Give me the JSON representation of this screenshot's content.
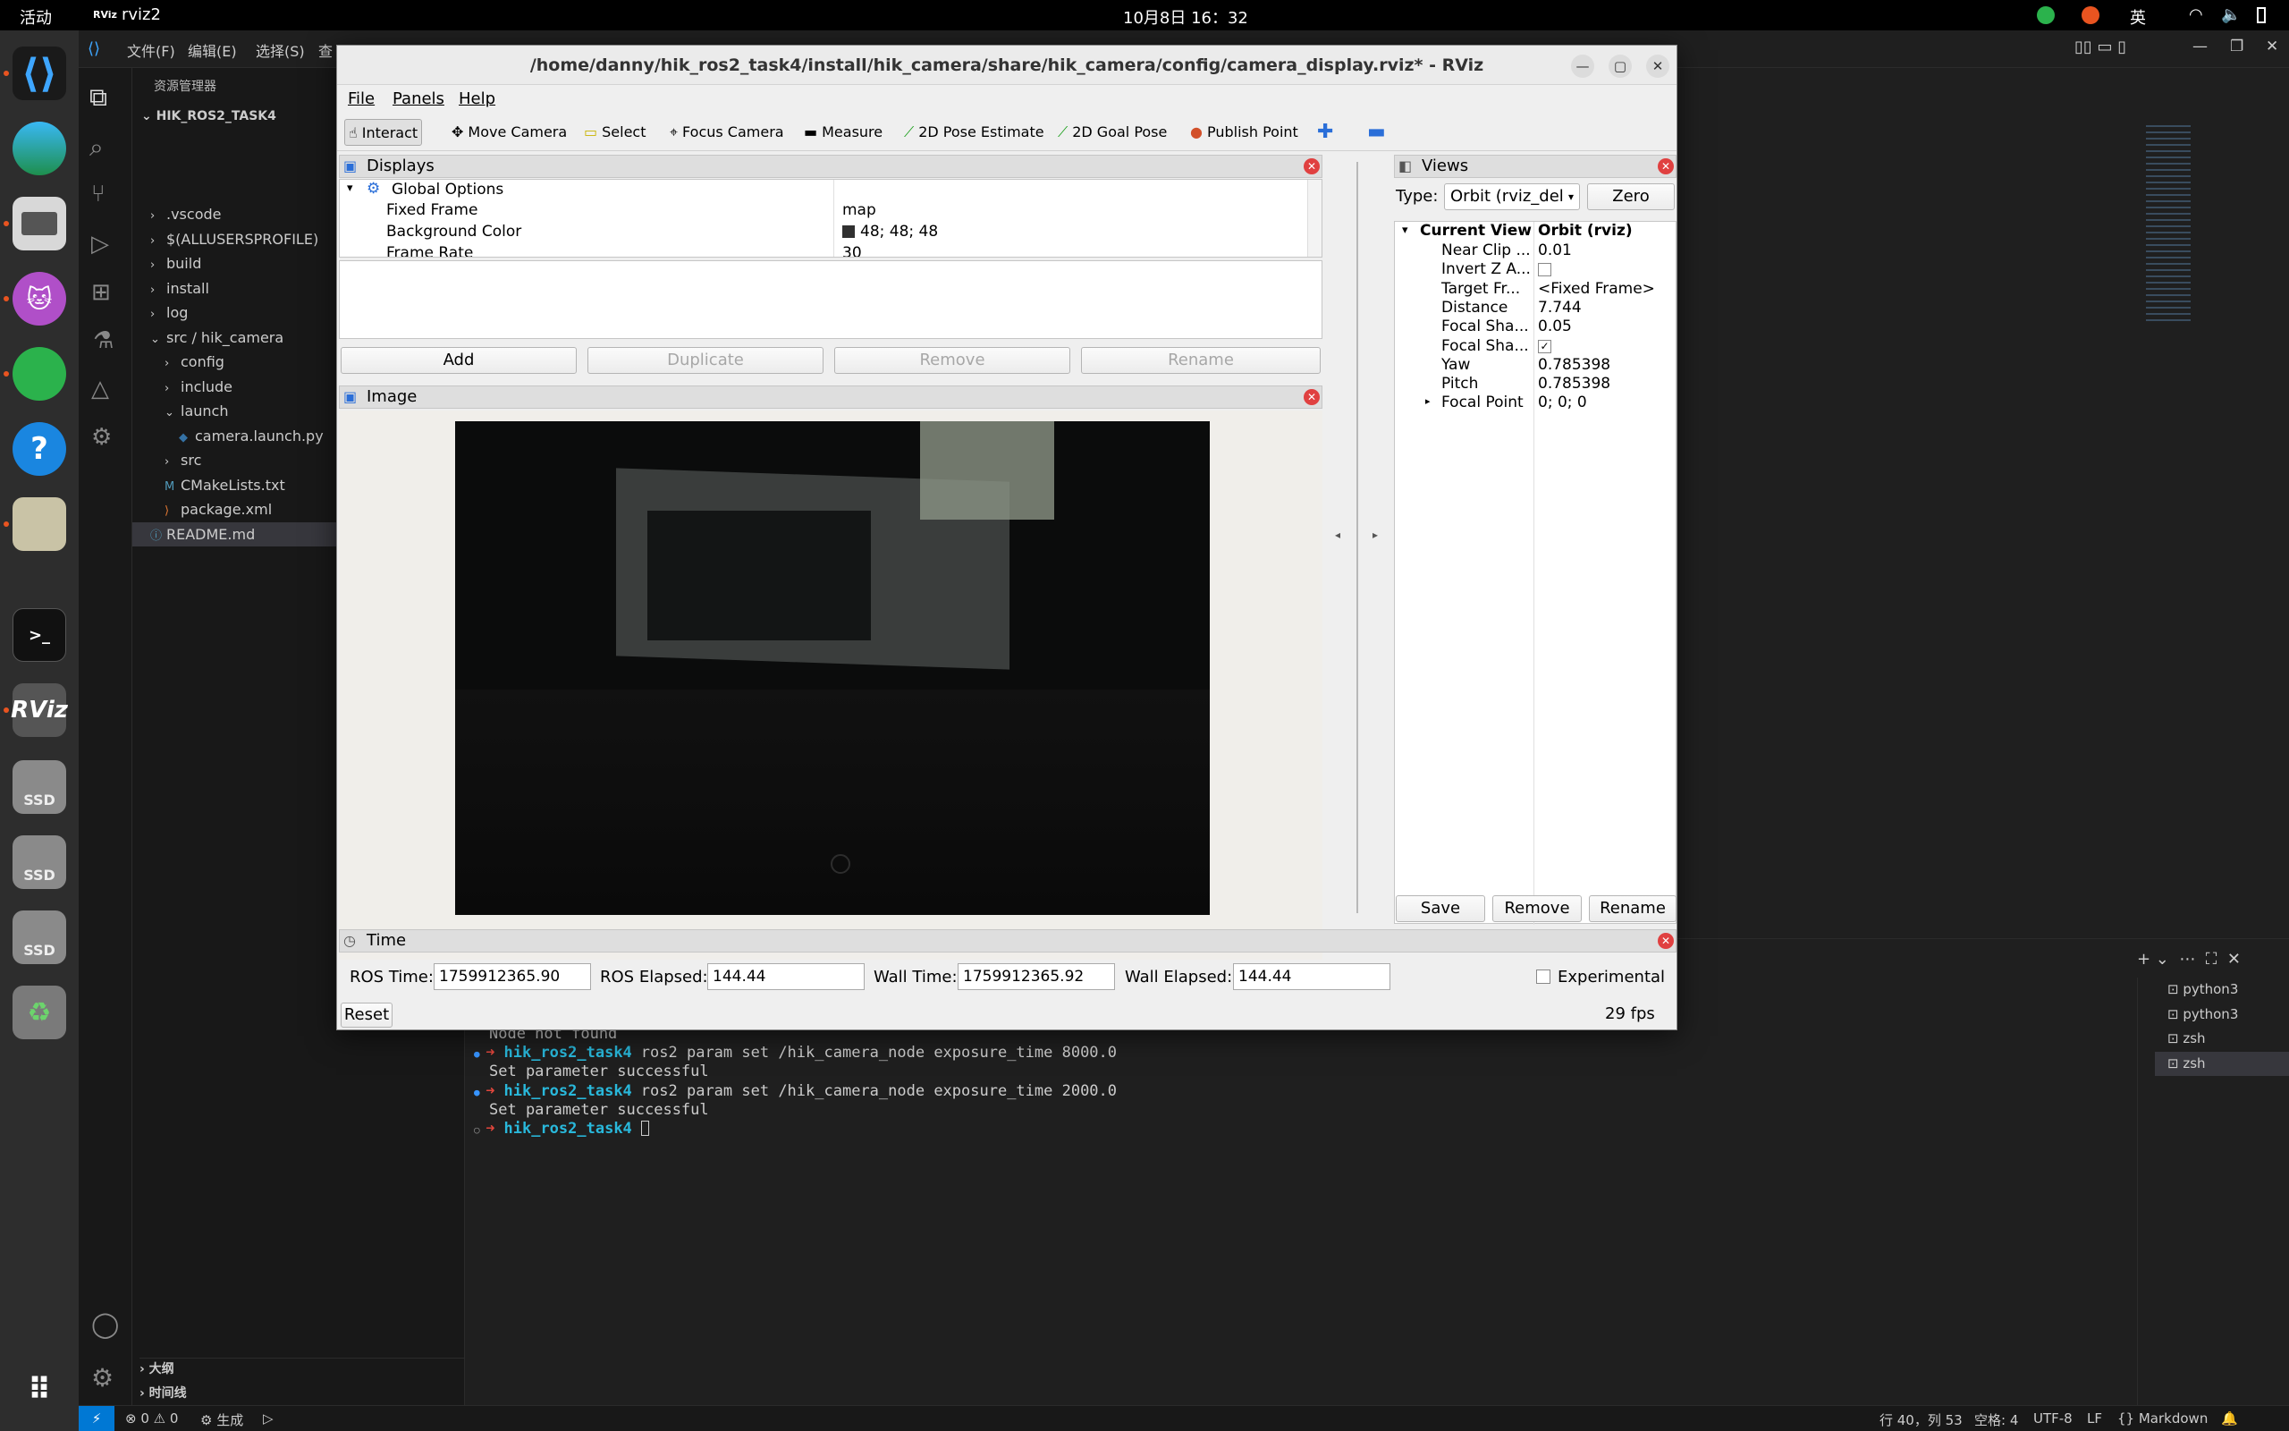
{
  "topbar": {
    "activities": "活动",
    "app_name": "rviz2",
    "clock": "10月8日  16：32",
    "ime": "英"
  },
  "vscode": {
    "menus": [
      "文件(F)",
      "编辑(E)",
      "选择(S)",
      "查"
    ],
    "explorer_title": "资源管理器",
    "project": "HIK_ROS2_TASK4",
    "tree": [
      {
        "label": ".vscode",
        "depth": 1,
        "kind": "folder",
        "open": false
      },
      {
        "label": "$(ALLUSERSPROFILE)",
        "depth": 1,
        "kind": "folder",
        "open": false
      },
      {
        "label": "build",
        "depth": 1,
        "kind": "folder",
        "open": false
      },
      {
        "label": "install",
        "depth": 1,
        "kind": "folder",
        "open": false
      },
      {
        "label": "log",
        "depth": 1,
        "kind": "folder",
        "open": false
      },
      {
        "label": "src / hik_camera",
        "depth": 1,
        "kind": "folder",
        "open": true
      },
      {
        "label": "config",
        "depth": 2,
        "kind": "folder",
        "open": false
      },
      {
        "label": "include",
        "depth": 2,
        "kind": "folder",
        "open": false
      },
      {
        "label": "launch",
        "depth": 2,
        "kind": "folder",
        "open": true
      },
      {
        "label": "camera.launch.py",
        "depth": 3,
        "kind": "py"
      },
      {
        "label": "src",
        "depth": 2,
        "kind": "folder",
        "open": false
      },
      {
        "label": "CMakeLists.txt",
        "depth": 2,
        "kind": "cmake"
      },
      {
        "label": "package.xml",
        "depth": 2,
        "kind": "xml"
      },
      {
        "label": "README.md",
        "depth": 1,
        "kind": "md"
      }
    ],
    "outline": "大纲",
    "timeline": "时间线",
    "terminal_lines": [
      {
        "arrow": "",
        "dir": "",
        "cmd": "Node not found"
      },
      {
        "arrow": "➜",
        "dir": "hik_ros2_task4",
        "cmd": "ros2 param set /hik_camera_node exposure_time 8000.0"
      },
      {
        "arrow": "",
        "dir": "",
        "cmd": "Set parameter successful"
      },
      {
        "arrow": "➜",
        "dir": "hik_ros2_task4",
        "cmd": "ros2 param set /hik_camera_node exposure_time 2000.0"
      },
      {
        "arrow": "",
        "dir": "",
        "cmd": "Set parameter successful"
      },
      {
        "arrow": "➜",
        "dir": "hik_ros2_task4",
        "cmd": ""
      }
    ],
    "terminals": [
      "python3",
      "python3",
      "zsh",
      "zsh"
    ],
    "status": {
      "errors": "0",
      "warnings": "0",
      "build": "生成",
      "position": "行 40，列 53",
      "spaces": "空格: 4",
      "encoding": "UTF-8",
      "eol": "LF",
      "language": "Markdown"
    }
  },
  "rviz": {
    "title": "/home/danny/hik_ros2_task4/install/hik_camera/share/hik_camera/config/camera_display.rviz* - RViz",
    "menu": [
      "File",
      "Panels",
      "Help"
    ],
    "tools": [
      "Interact",
      "Move Camera",
      "Select",
      "Focus Camera",
      "Measure",
      "2D Pose Estimate",
      "2D Goal Pose",
      "Publish Point"
    ],
    "displays": {
      "title": "Displays",
      "global": "Global Options",
      "rows": [
        {
          "name": "Fixed Frame",
          "value": "map"
        },
        {
          "name": "Background Color",
          "value": "48; 48; 48"
        },
        {
          "name": "Frame Rate",
          "value": "30"
        }
      ],
      "buttons": [
        "Add",
        "Duplicate",
        "Remove",
        "Rename"
      ]
    },
    "image_panel": {
      "title": "Image"
    },
    "views": {
      "title": "Views",
      "type_label": "Type:",
      "type_value": "Orbit (rviz_del",
      "zero": "Zero",
      "current_view": "Current View",
      "current_view_value": "Orbit (rviz)",
      "props": [
        {
          "name": "Near Clip ...",
          "value": "0.01"
        },
        {
          "name": "Invert Z A...",
          "value": ""
        },
        {
          "name": "Target Fr...",
          "value": "<Fixed Frame>"
        },
        {
          "name": "Distance",
          "value": "7.744"
        },
        {
          "name": "Focal Sha...",
          "value": "0.05"
        },
        {
          "name": "Focal Sha...",
          "value": "✓"
        },
        {
          "name": "Yaw",
          "value": "0.785398"
        },
        {
          "name": "Pitch",
          "value": "0.785398"
        },
        {
          "name": "Focal Point",
          "value": "0; 0; 0"
        }
      ],
      "buttons": [
        "Save",
        "Remove",
        "Rename"
      ]
    },
    "time": {
      "title": "Time",
      "ros_time_label": "ROS Time:",
      "ros_time": "1759912365.90",
      "ros_elapsed_label": "ROS Elapsed:",
      "ros_elapsed": "144.44",
      "wall_time_label": "Wall Time:",
      "wall_time": "1759912365.92",
      "wall_elapsed_label": "Wall Elapsed:",
      "wall_elapsed": "144.44",
      "experimental": "Experimental",
      "reset": "Reset",
      "fps": "29 fps"
    }
  },
  "colors": {
    "accent": "#0078d4",
    "terminal_dir": "#29b8db",
    "terminal_arrow": "#e0463c",
    "rviz_bg": "#efefef"
  }
}
